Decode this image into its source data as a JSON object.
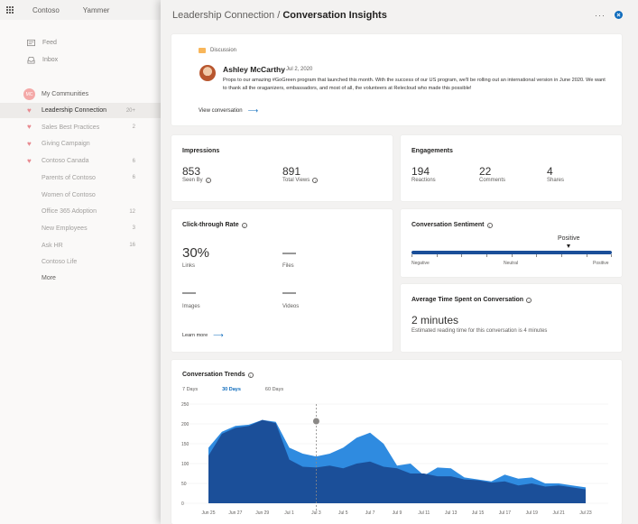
{
  "app": {
    "brand": "Contoso",
    "product": "Yammer"
  },
  "sidebar": {
    "feed": "Feed",
    "inbox": "Inbox",
    "communities_header": "My Communities",
    "communities_avatar": "MC",
    "items": [
      {
        "label": "Leadership Connection",
        "count": "20+",
        "favorite": true,
        "active": true
      },
      {
        "label": "Sales Best Practices",
        "count": "2",
        "favorite": true
      },
      {
        "label": "Giving Campaign",
        "count": "",
        "favorite": true
      },
      {
        "label": "Contoso Canada",
        "count": "6",
        "favorite": true
      },
      {
        "label": "Parents of Contoso",
        "count": "6",
        "favorite": false
      },
      {
        "label": "Women of Contoso",
        "count": "",
        "favorite": false
      },
      {
        "label": "Office 365 Adoption",
        "count": "12",
        "favorite": false
      },
      {
        "label": "New Employees",
        "count": "3",
        "favorite": false
      },
      {
        "label": "Ask HR",
        "count": "16",
        "favorite": false
      },
      {
        "label": "Contoso Life",
        "count": "",
        "favorite": false
      }
    ],
    "more": "More"
  },
  "panel": {
    "breadcrumb": "Leadership Connection",
    "separator": " / ",
    "title": "Conversation Insights",
    "more_label": "···"
  },
  "post": {
    "tag": "Discussion",
    "author": "Ashley McCarthy",
    "date": "Jul 2, 2020",
    "text": "Props to our amazing #GoGreen program that launched this month. With the success of our US program, we'll be rolling out an international version in June 2020. We want to thank all the oraganizers, embassadors, and most of all, the volunteers at Relecloud who made this possible!",
    "view_link": "View conversation"
  },
  "impressions": {
    "title": "Impressions",
    "seen_by_value": "853",
    "seen_by_label": "Seen By",
    "views_value": "891",
    "views_label": "Total Views"
  },
  "engagements": {
    "title": "Engagements",
    "reactions_value": "194",
    "reactions_label": "Reactions",
    "comments_value": "22",
    "comments_label": "Comments",
    "shares_value": "4",
    "shares_label": "Shares"
  },
  "ctr": {
    "title": "Click-through Rate",
    "links_value": "30%",
    "links_label": "Links",
    "files_value": "—",
    "files_label": "Files",
    "images_value": "—",
    "images_label": "Images",
    "videos_value": "—",
    "videos_label": "Videos",
    "learn_more": "Learn more"
  },
  "sentiment": {
    "title": "Conversation Sentiment",
    "current": "Positive",
    "current_position": 0.8,
    "negative": "Negative",
    "neutral": "Neutral",
    "positive": "Positive"
  },
  "time_spent": {
    "title": "Average Time Spent on Conversation",
    "value": "2 minutes",
    "caption": "Estimated reading time for this conversation is 4 minutes"
  },
  "trends": {
    "title": "Conversation Trends",
    "tabs": [
      {
        "label": "7 Days",
        "active": false
      },
      {
        "label": "30 Days",
        "active": true
      },
      {
        "label": "60 Days",
        "active": false
      }
    ]
  },
  "colors": {
    "accent": "#0f6cbd",
    "area_dark": "#1b4f99",
    "area_light": "#2f8be0",
    "heart": "#e88b91"
  },
  "chart_data": {
    "type": "area",
    "title": "Conversation Trends",
    "x": [
      "Jun 25",
      "Jun 26",
      "Jun 27",
      "Jun 28",
      "Jun 29",
      "Jun 30",
      "Jul 1",
      "Jul 2",
      "Jul 3",
      "Jul 4",
      "Jul 5",
      "Jul 6",
      "Jul 7",
      "Jul 8",
      "Jul 9",
      "Jul 10",
      "Jul 11",
      "Jul 12",
      "Jul 13",
      "Jul 14",
      "Jul 15",
      "Jul 16",
      "Jul 17",
      "Jul 18",
      "Jul 19",
      "Jul 20",
      "Jul 21",
      "Jul 22",
      "Jul 23"
    ],
    "tick_labels": [
      "Jun 25",
      "Jun 27",
      "Jun 29",
      "Jul 1",
      "Jul 3",
      "Jul 5",
      "Jul 7",
      "Jul 9",
      "Jul 11",
      "Jul 13",
      "Jul 15",
      "Jul 17",
      "Jul 19",
      "Jul 21",
      "Jul 23"
    ],
    "series": [
      {
        "values": [
          120,
          175,
          190,
          195,
          210,
          202,
          110,
          92,
          90,
          95,
          88,
          100,
          105,
          92,
          88,
          75,
          75,
          68,
          68,
          60,
          58,
          52,
          55,
          45,
          50,
          42,
          45,
          40,
          35
        ]
      },
      {
        "values": [
          140,
          180,
          195,
          198,
          210,
          205,
          140,
          125,
          118,
          125,
          140,
          165,
          178,
          150,
          95,
          100,
          70,
          90,
          88,
          65,
          60,
          55,
          72,
          62,
          65,
          50,
          50,
          45,
          40
        ]
      }
    ],
    "ylim": [
      0,
      250
    ],
    "yticks": [
      0,
      50,
      100,
      150,
      200,
      250
    ],
    "marker_x": "Jul 3",
    "grid": true
  }
}
